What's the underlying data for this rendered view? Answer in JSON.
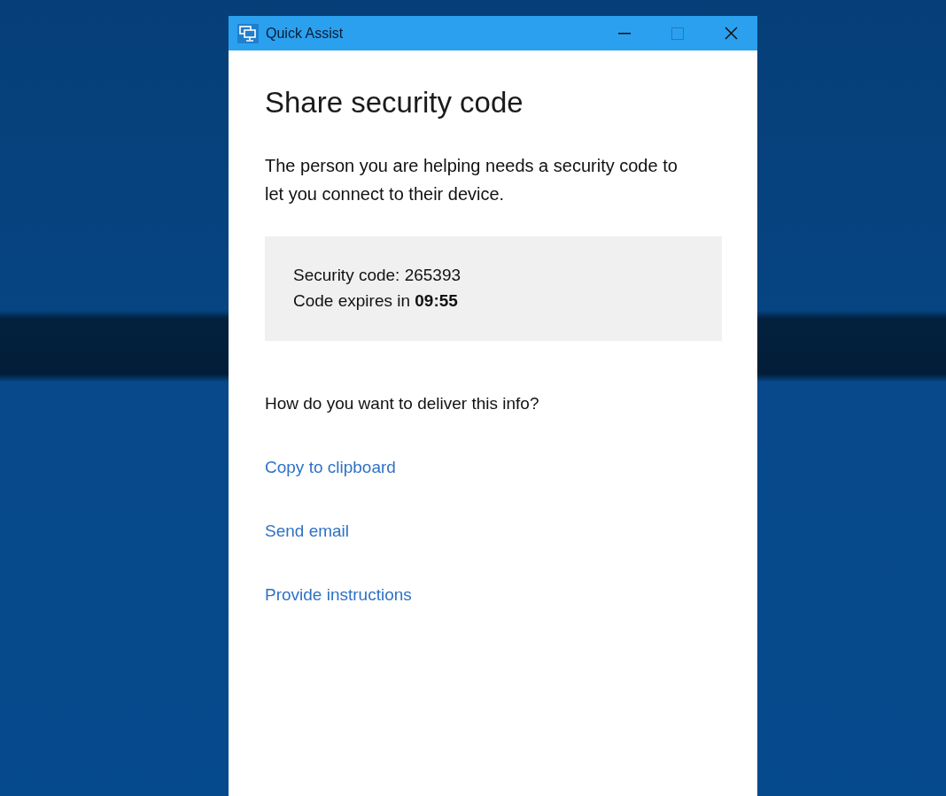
{
  "window": {
    "title": "Quick Assist",
    "maximize_disabled": true
  },
  "heading": "Share security code",
  "description": "The person you are helping needs a security code to let you connect to their device.",
  "code_panel": {
    "lines": [
      "Security code: 265393",
      "Code expires in **09:55**"
    ]
  },
  "question": "How do you want to deliver this info?",
  "links": [
    "Copy to clipboard",
    "Send email",
    "Provide instructions"
  ]
}
